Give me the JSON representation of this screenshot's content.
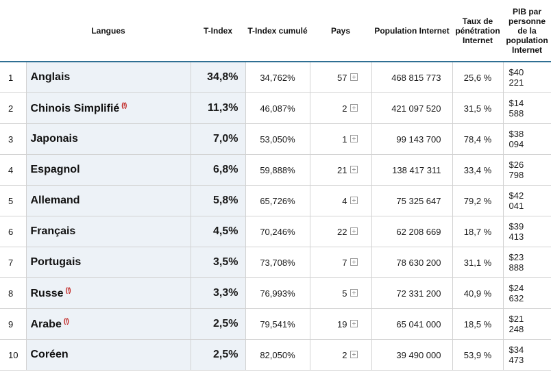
{
  "headers": {
    "rank": "",
    "langues": "Langues",
    "tindex": "T-Index",
    "cumul": "T-Index cumulé",
    "pays": "Pays",
    "population": "Population Internet",
    "taux": "Taux de pénétration Internet",
    "pib": "PIB par personne de la population Internet"
  },
  "warning_mark": "(!)",
  "rows": [
    {
      "rank": "1",
      "lang": "Anglais",
      "warn": false,
      "tindex": "34,8%",
      "cumul": "34,762%",
      "pays": "57",
      "population": "468 815 773",
      "taux": "25,6 %",
      "pib_a": "$40",
      "pib_b": "221"
    },
    {
      "rank": "2",
      "lang": "Chinois Simplifié",
      "warn": true,
      "tindex": "11,3%",
      "cumul": "46,087%",
      "pays": "2",
      "population": "421 097 520",
      "taux": "31,5 %",
      "pib_a": "$14",
      "pib_b": "588"
    },
    {
      "rank": "3",
      "lang": "Japonais",
      "warn": false,
      "tindex": "7,0%",
      "cumul": "53,050%",
      "pays": "1",
      "population": "99 143 700",
      "taux": "78,4 %",
      "pib_a": "$38",
      "pib_b": "094"
    },
    {
      "rank": "4",
      "lang": "Espagnol",
      "warn": false,
      "tindex": "6,8%",
      "cumul": "59,888%",
      "pays": "21",
      "population": "138 417 311",
      "taux": "33,4 %",
      "pib_a": "$26",
      "pib_b": "798"
    },
    {
      "rank": "5",
      "lang": "Allemand",
      "warn": false,
      "tindex": "5,8%",
      "cumul": "65,726%",
      "pays": "4",
      "population": "75 325 647",
      "taux": "79,2 %",
      "pib_a": "$42",
      "pib_b": "041"
    },
    {
      "rank": "6",
      "lang": "Français",
      "warn": false,
      "tindex": "4,5%",
      "cumul": "70,246%",
      "pays": "22",
      "population": "62 208 669",
      "taux": "18,7 %",
      "pib_a": "$39",
      "pib_b": "413"
    },
    {
      "rank": "7",
      "lang": "Portugais",
      "warn": false,
      "tindex": "3,5%",
      "cumul": "73,708%",
      "pays": "7",
      "population": "78 630 200",
      "taux": "31,1 %",
      "pib_a": "$23",
      "pib_b": "888"
    },
    {
      "rank": "8",
      "lang": "Russe",
      "warn": true,
      "tindex": "3,3%",
      "cumul": "76,993%",
      "pays": "5",
      "population": "72 331 200",
      "taux": "40,9 %",
      "pib_a": "$24",
      "pib_b": "632"
    },
    {
      "rank": "9",
      "lang": "Arabe",
      "warn": true,
      "tindex": "2,5%",
      "cumul": "79,541%",
      "pays": "19",
      "population": "65 041 000",
      "taux": "18,5 %",
      "pib_a": "$21",
      "pib_b": "248"
    },
    {
      "rank": "10",
      "lang": "Coréen",
      "warn": false,
      "tindex": "2,5%",
      "cumul": "82,050%",
      "pays": "2",
      "population": "39 490 000",
      "taux": "53,9 %",
      "pib_a": "$34",
      "pib_b": "473"
    }
  ]
}
